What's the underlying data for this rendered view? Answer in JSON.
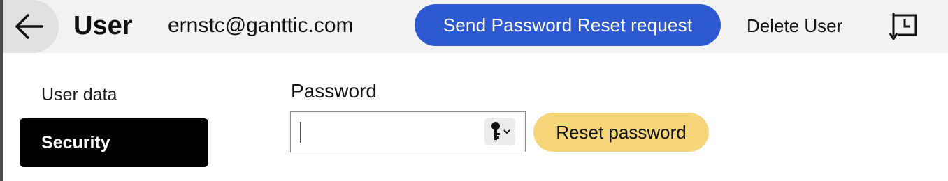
{
  "header": {
    "back_icon": "arrow-left-icon",
    "title": "User",
    "email": "ernstc@ganttic.com",
    "send_reset_label": "Send Password Reset request",
    "delete_label": "Delete User",
    "history_icon": "history-clock-icon"
  },
  "sidebar": {
    "items": [
      {
        "label": "User data",
        "active": false
      },
      {
        "label": "Security",
        "active": true
      }
    ]
  },
  "main": {
    "password_label": "Password",
    "password_value": "",
    "key_icon": "key-dropdown-icon",
    "reset_password_label": "Reset password"
  },
  "colors": {
    "primary_button": "#2d5ad1",
    "secondary_button": "#f7d57a",
    "header_background": "#f2f2f2",
    "active_nav": "#000000"
  }
}
